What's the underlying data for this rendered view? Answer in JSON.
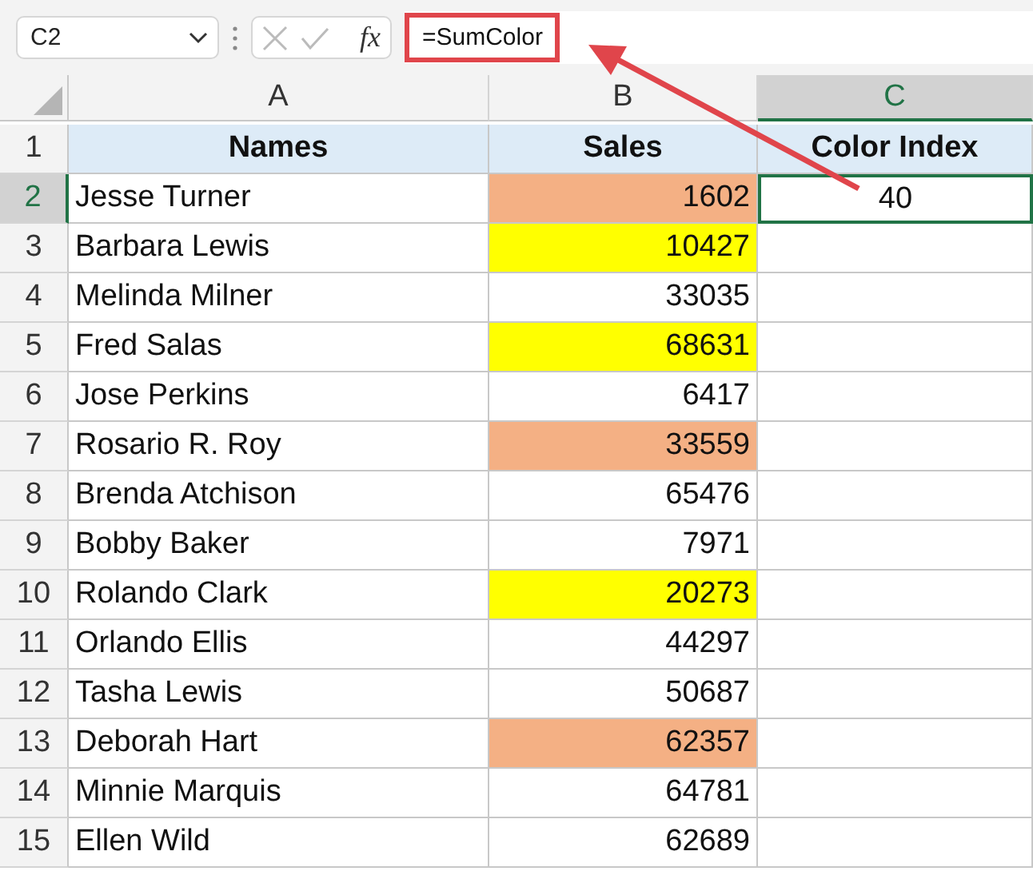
{
  "name_box": {
    "value": "C2"
  },
  "formula_bar": {
    "function_label": "fx",
    "value": "=SumColor",
    "highlighted": true
  },
  "columns": [
    {
      "label": "A",
      "selected": false
    },
    {
      "label": "B",
      "selected": false
    },
    {
      "label": "C",
      "selected": true
    }
  ],
  "header_row": {
    "number": "1",
    "cells": [
      "Names",
      "Sales",
      "Color Index"
    ]
  },
  "rows": [
    {
      "number": "2",
      "name": "Jesse Turner",
      "sales": "1602",
      "color": "#f4b084",
      "color_index": "40",
      "selected": true
    },
    {
      "number": "3",
      "name": "Barbara Lewis",
      "sales": "10427",
      "color": "#ffff00",
      "selected": false
    },
    {
      "number": "4",
      "name": "Melinda Milner",
      "sales": "33035",
      "selected": false
    },
    {
      "number": "5",
      "name": "Fred Salas",
      "sales": "68631",
      "color": "#ffff00",
      "selected": false
    },
    {
      "number": "6",
      "name": "Jose Perkins",
      "sales": "6417",
      "selected": false
    },
    {
      "number": "7",
      "name": "Rosario R. Roy",
      "sales": "33559",
      "color": "#f4b084",
      "selected": false
    },
    {
      "number": "8",
      "name": "Brenda Atchison",
      "sales": "65476",
      "selected": false
    },
    {
      "number": "9",
      "name": "Bobby Baker",
      "sales": "7971",
      "selected": false
    },
    {
      "number": "10",
      "name": "Rolando Clark",
      "sales": "20273",
      "color": "#ffff00",
      "selected": false
    },
    {
      "number": "11",
      "name": "Orlando Ellis",
      "sales": "44297",
      "selected": false
    },
    {
      "number": "12",
      "name": "Tasha Lewis",
      "sales": "50687",
      "selected": false
    },
    {
      "number": "13",
      "name": "Deborah Hart",
      "sales": "62357",
      "color": "#f4b084",
      "selected": false
    },
    {
      "number": "14",
      "name": "Minnie Marquis",
      "sales": "64781",
      "selected": false
    },
    {
      "number": "15",
      "name": "Ellen Wild",
      "sales": "62689",
      "selected": false
    }
  ]
}
